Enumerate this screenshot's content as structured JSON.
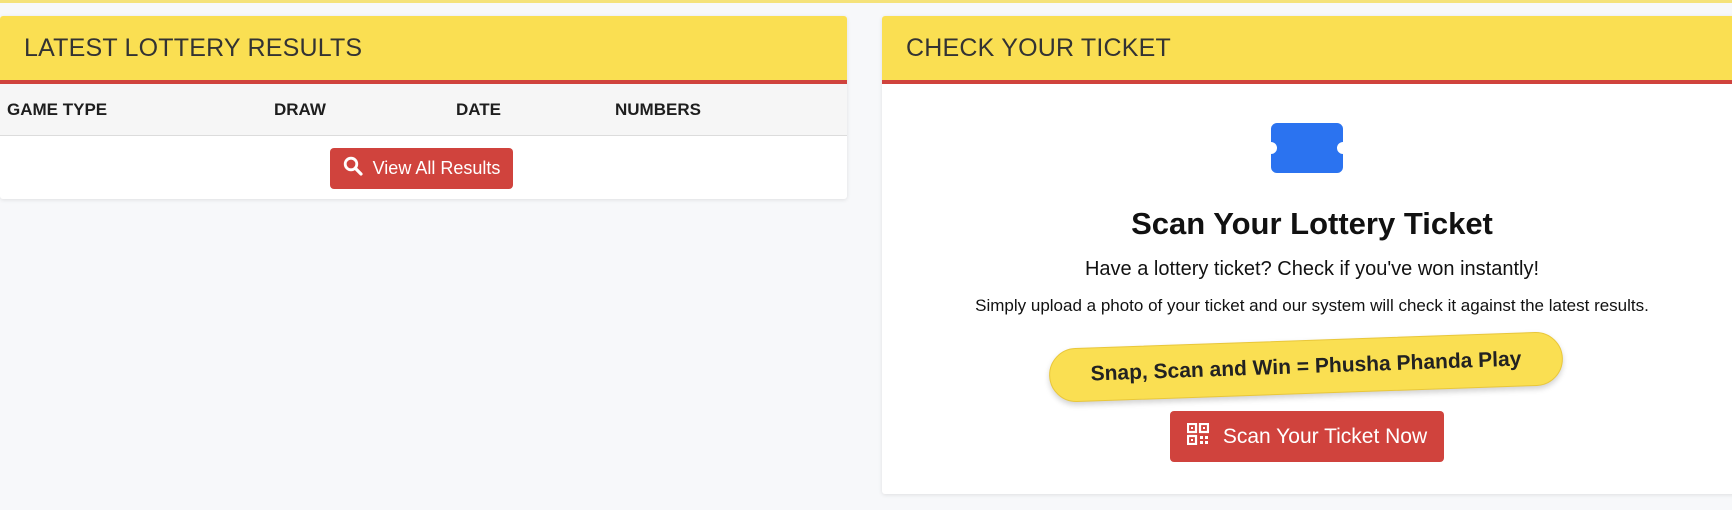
{
  "results_card": {
    "title": "LATEST LOTTERY RESULTS",
    "columns": [
      "GAME TYPE",
      "DRAW",
      "DATE",
      "NUMBERS"
    ],
    "rows": [],
    "view_all_label": "View All Results",
    "view_all_icon": "search-icon"
  },
  "check_card": {
    "title": "CHECK YOUR TICKET",
    "ticket_icon": "ticket-icon",
    "heading": "Scan Your Lottery Ticket",
    "subheading": "Have a lottery ticket? Check if you've won instantly!",
    "description": "Simply upload a photo of your ticket and our system will check it against the latest results.",
    "slogan": "Snap, Scan and Win = Phusha Phanda Play",
    "scan_button_label": "Scan Your Ticket Now",
    "scan_button_icon": "qr-code-icon"
  },
  "colors": {
    "header_yellow": "#fadf52",
    "accent_red": "#d0433d",
    "ticket_blue": "#2b73f0"
  }
}
